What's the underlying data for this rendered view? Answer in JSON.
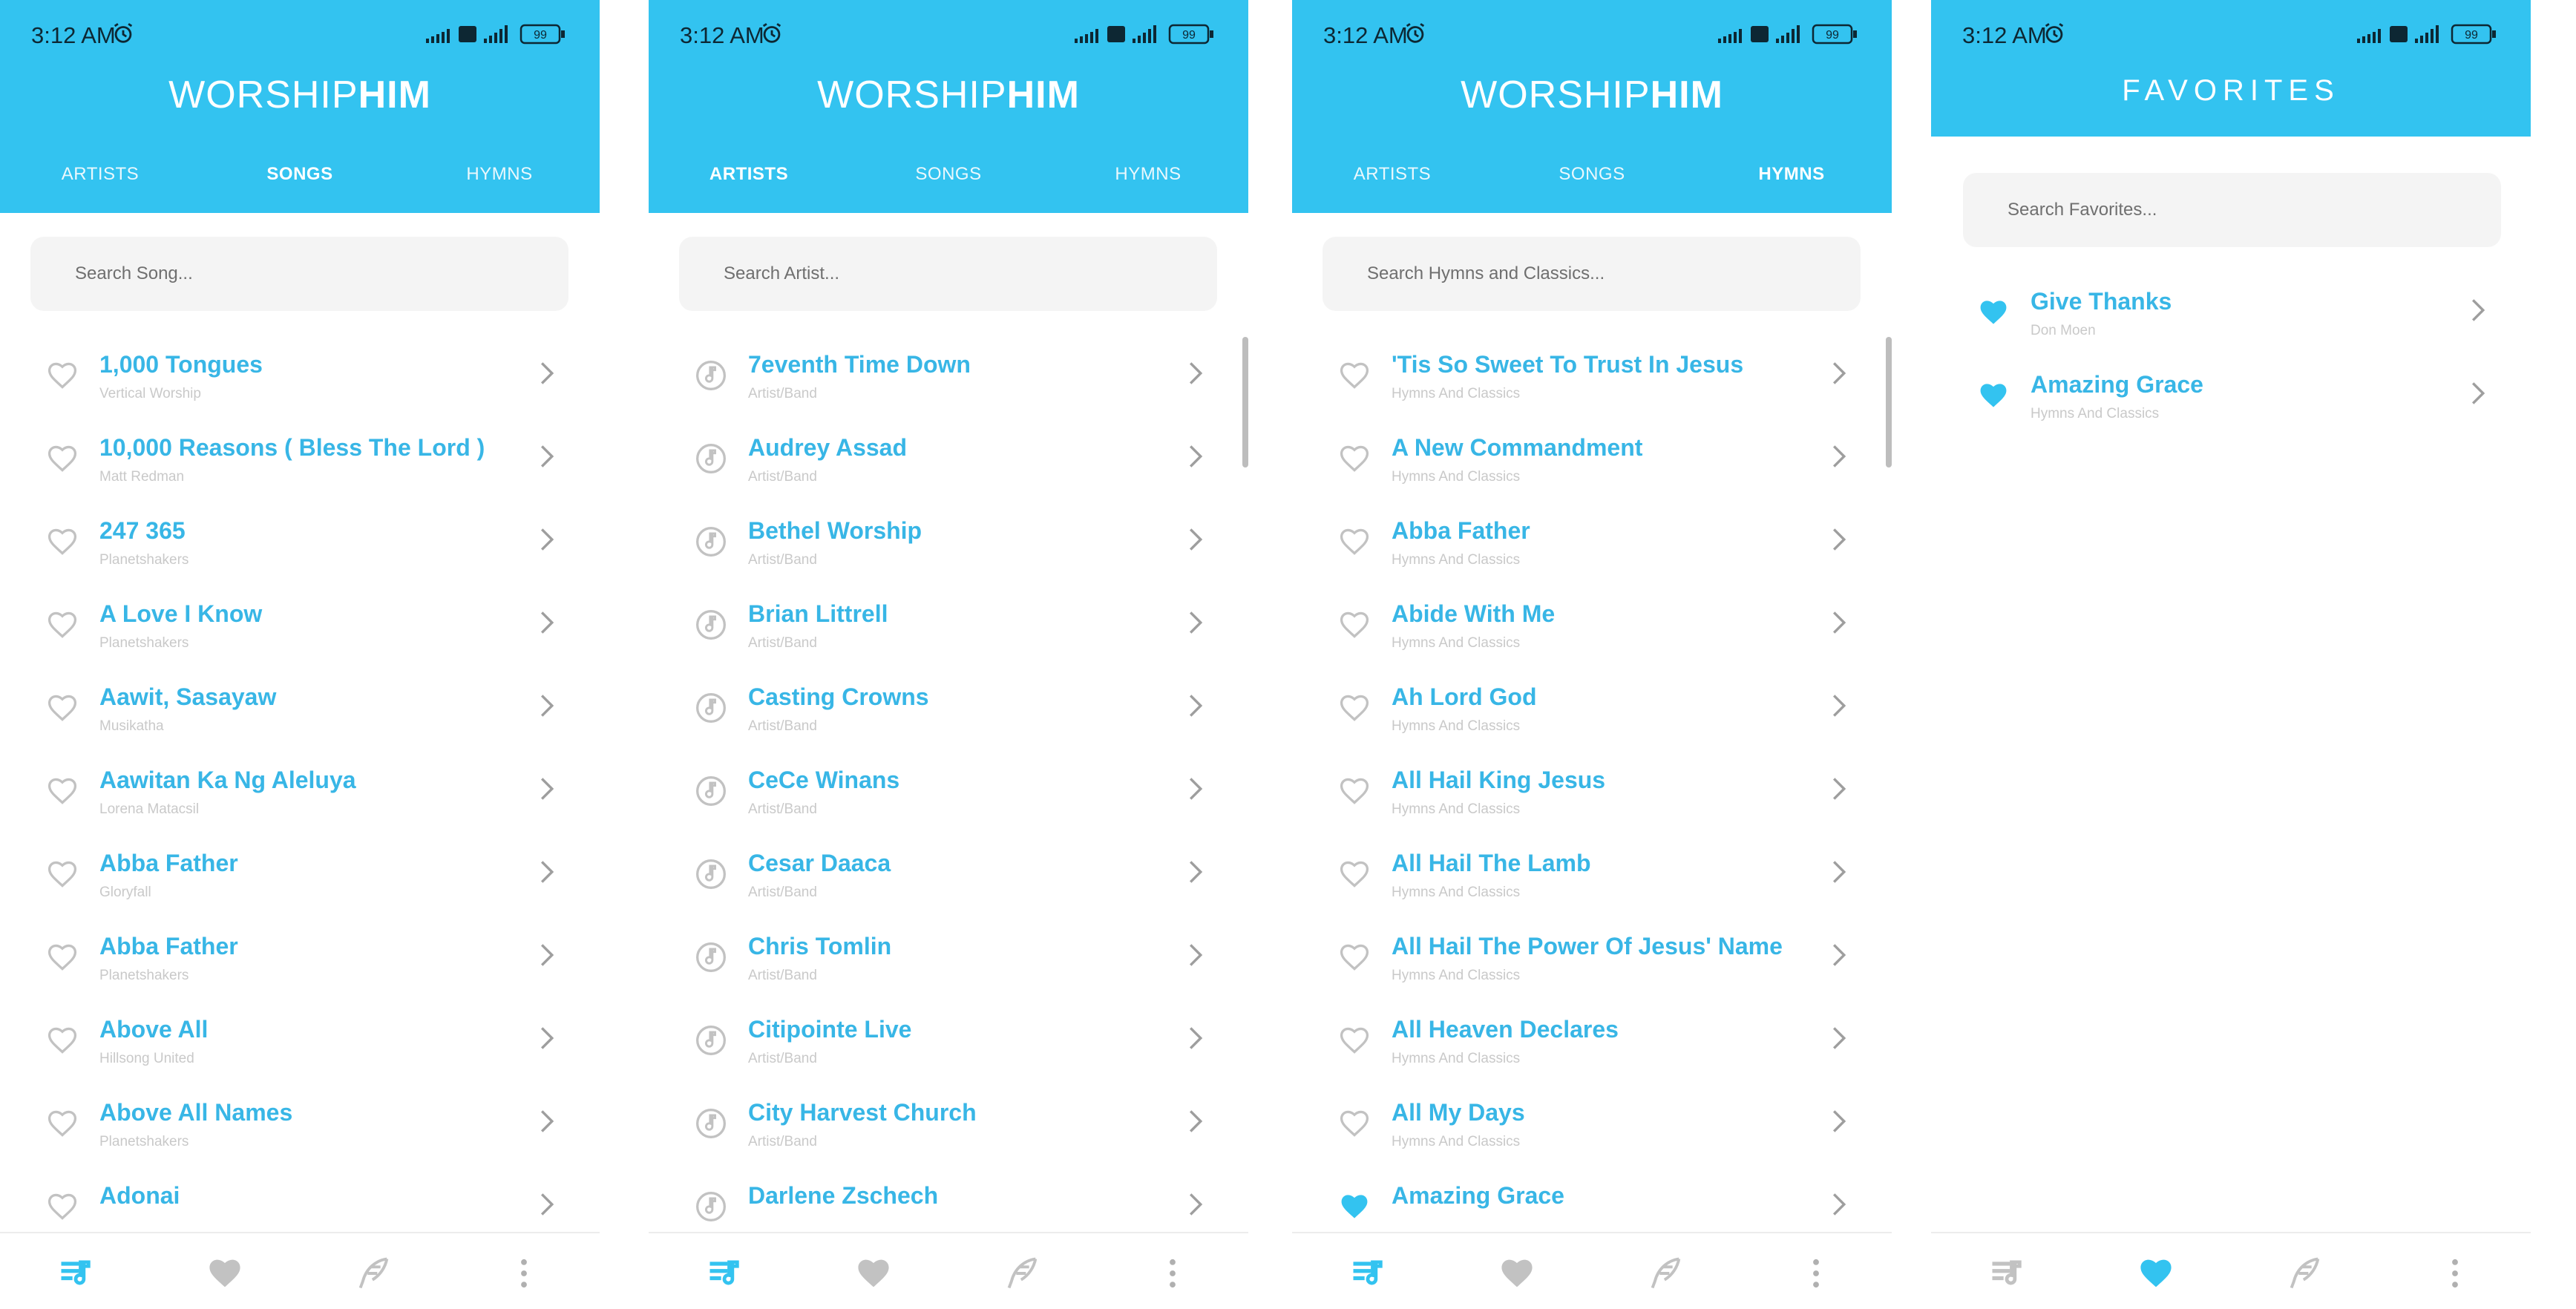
{
  "colors": {
    "header": "#33c3f0",
    "title_text": "#38b6e6",
    "subtitle_text": "#c9c9c9",
    "icon_gray": "#c2c2c2",
    "accent": "#33c3f0"
  },
  "status_bar": {
    "time": "3:12 AM",
    "battery": "99"
  },
  "brand": {
    "part1": "WORSHIP",
    "part2": "HIM"
  },
  "tabs": [
    "ARTISTS",
    "SONGS",
    "HYMNS"
  ],
  "nav_icons": [
    "playlist-icon",
    "heart-icon",
    "feather-icon",
    "more-vertical-icon"
  ],
  "screens": [
    {
      "active_tab": "SONGS",
      "search_placeholder": "Search Song...",
      "active_nav": "playlist-icon",
      "items": [
        {
          "title": "1,000 Tongues",
          "subtitle": "Vertical Worship",
          "icon": "heart-outline-icon"
        },
        {
          "title": "10,000 Reasons ( Bless The Lord )",
          "subtitle": "Matt Redman",
          "icon": "heart-outline-icon"
        },
        {
          "title": "247 365",
          "subtitle": "Planetshakers",
          "icon": "heart-outline-icon"
        },
        {
          "title": "A Love I Know",
          "subtitle": "Planetshakers",
          "icon": "heart-outline-icon"
        },
        {
          "title": "Aawit, Sasayaw",
          "subtitle": "Musikatha",
          "icon": "heart-outline-icon"
        },
        {
          "title": "Aawitan Ka Ng Aleluya",
          "subtitle": "Lorena Matacsil",
          "icon": "heart-outline-icon"
        },
        {
          "title": "Abba Father",
          "subtitle": "Gloryfall",
          "icon": "heart-outline-icon"
        },
        {
          "title": "Abba Father",
          "subtitle": "Planetshakers",
          "icon": "heart-outline-icon"
        },
        {
          "title": "Above All",
          "subtitle": "Hillsong United",
          "icon": "heart-outline-icon"
        },
        {
          "title": "Above All Names",
          "subtitle": "Planetshakers",
          "icon": "heart-outline-icon"
        },
        {
          "title": "Adonai",
          "subtitle": "",
          "icon": "heart-outline-icon"
        }
      ]
    },
    {
      "active_tab": "ARTISTS",
      "search_placeholder": "Search Artist...",
      "active_nav": "playlist-icon",
      "items": [
        {
          "title": "7eventh Time Down",
          "subtitle": "Artist/Band",
          "icon": "music-note-icon"
        },
        {
          "title": "Audrey Assad",
          "subtitle": "Artist/Band",
          "icon": "music-note-icon"
        },
        {
          "title": "Bethel Worship",
          "subtitle": "Artist/Band",
          "icon": "music-note-icon"
        },
        {
          "title": "Brian Littrell",
          "subtitle": "Artist/Band",
          "icon": "music-note-icon"
        },
        {
          "title": "Casting Crowns",
          "subtitle": "Artist/Band",
          "icon": "music-note-icon"
        },
        {
          "title": "CeCe Winans",
          "subtitle": "Artist/Band",
          "icon": "music-note-icon"
        },
        {
          "title": "Cesar Daaca",
          "subtitle": "Artist/Band",
          "icon": "music-note-icon"
        },
        {
          "title": "Chris Tomlin",
          "subtitle": "Artist/Band",
          "icon": "music-note-icon"
        },
        {
          "title": "Citipointe Live",
          "subtitle": "Artist/Band",
          "icon": "music-note-icon"
        },
        {
          "title": "City Harvest Church",
          "subtitle": "Artist/Band",
          "icon": "music-note-icon"
        },
        {
          "title": "Darlene Zschech",
          "subtitle": "",
          "icon": "music-note-icon"
        }
      ]
    },
    {
      "active_tab": "HYMNS",
      "search_placeholder": "Search Hymns and Classics...",
      "active_nav": "playlist-icon",
      "items": [
        {
          "title": "'Tis So Sweet To Trust In Jesus",
          "subtitle": "Hymns And Classics",
          "icon": "heart-outline-icon"
        },
        {
          "title": "A New Commandment",
          "subtitle": "Hymns And Classics",
          "icon": "heart-outline-icon"
        },
        {
          "title": "Abba Father",
          "subtitle": "Hymns And Classics",
          "icon": "heart-outline-icon"
        },
        {
          "title": "Abide With Me",
          "subtitle": "Hymns And Classics",
          "icon": "heart-outline-icon"
        },
        {
          "title": "Ah Lord God",
          "subtitle": "Hymns And Classics",
          "icon": "heart-outline-icon"
        },
        {
          "title": "All Hail King Jesus",
          "subtitle": "Hymns And Classics",
          "icon": "heart-outline-icon"
        },
        {
          "title": "All Hail The Lamb",
          "subtitle": "Hymns And Classics",
          "icon": "heart-outline-icon"
        },
        {
          "title": "All Hail The Power Of Jesus' Name",
          "subtitle": "Hymns And Classics",
          "icon": "heart-outline-icon"
        },
        {
          "title": "All Heaven Declares",
          "subtitle": "Hymns And Classics",
          "icon": "heart-outline-icon"
        },
        {
          "title": "All My Days",
          "subtitle": "Hymns And Classics",
          "icon": "heart-outline-icon"
        },
        {
          "title": "Amazing Grace",
          "subtitle": "",
          "icon": "heart-filled-icon"
        }
      ]
    },
    {
      "title": "FAVORITES",
      "search_placeholder": "Search Favorites...",
      "active_nav": "heart-icon",
      "items": [
        {
          "title": "Give Thanks",
          "subtitle": "Don Moen",
          "icon": "heart-filled-icon"
        },
        {
          "title": "Amazing Grace",
          "subtitle": "Hymns And Classics",
          "icon": "heart-filled-icon"
        }
      ]
    }
  ]
}
